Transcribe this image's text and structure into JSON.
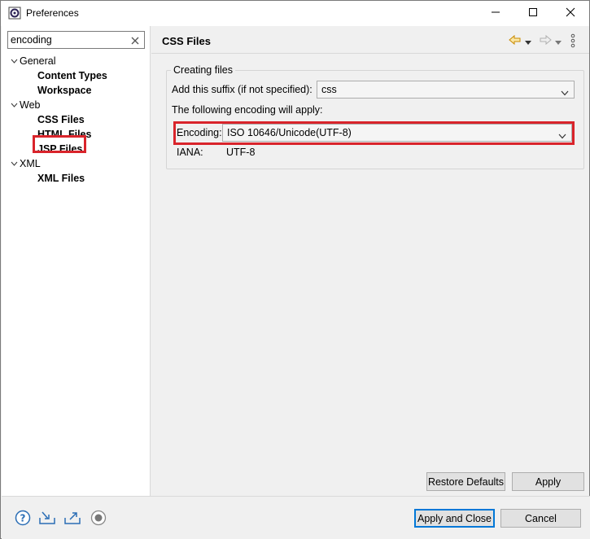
{
  "window": {
    "title": "Preferences"
  },
  "filter": {
    "value": "encoding"
  },
  "tree": {
    "general": "General",
    "content_types": "Content Types",
    "workspace": "Workspace",
    "web": "Web",
    "css_files": "CSS Files",
    "html_files": "HTML Files",
    "jsp_files": "JSP Files",
    "xml": "XML",
    "xml_files": "XML Files"
  },
  "page": {
    "title": "CSS Files",
    "group_title": "Creating files",
    "suffix_label": "Add this suffix (if not specified):",
    "suffix_value": "css",
    "encoding_note": "The following encoding will apply:",
    "encoding_label": "Encoding:",
    "encoding_value": "ISO 10646/Unicode(UTF-8)",
    "iana_label": "IANA:",
    "iana_value": "UTF-8",
    "restore_defaults": "Restore Defaults",
    "apply": "Apply"
  },
  "footer": {
    "apply_and_close": "Apply and Close",
    "cancel": "Cancel"
  },
  "colors": {
    "highlight": "#d9242b",
    "nav_back": "#e6a817",
    "accent": "#0078d7"
  }
}
